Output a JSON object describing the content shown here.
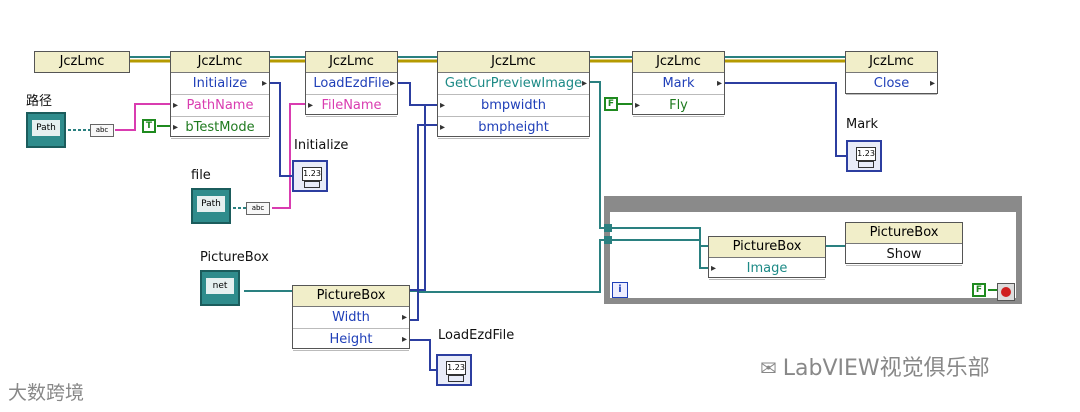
{
  "nodes": {
    "ctor": {
      "title": "JczLmc"
    },
    "init": {
      "title": "JczLmc",
      "rows": [
        "Initialize",
        "PathName",
        "bTestMode"
      ]
    },
    "load": {
      "title": "JczLmc",
      "rows": [
        "LoadEzdFile",
        "FileName"
      ]
    },
    "preview": {
      "title": "JczLmc",
      "rows": [
        "GetCurPreviewImage",
        "bmpwidth",
        "bmpheight"
      ]
    },
    "mark": {
      "title": "JczLmc",
      "rows": [
        "Mark",
        "Fly"
      ]
    },
    "close": {
      "title": "JczLmc",
      "rows": [
        "Close"
      ]
    },
    "pb_props": {
      "title": "PictureBox",
      "rows": [
        "Width",
        "Height"
      ]
    },
    "pb_image": {
      "title": "PictureBox",
      "rows": [
        "Image"
      ]
    },
    "pb_show": {
      "title": "PictureBox",
      "rows": [
        "Show"
      ]
    }
  },
  "labels": {
    "path": "路径",
    "file": "file",
    "picturebox": "PictureBox",
    "ind_initialize": "Initialize",
    "ind_load": "LoadEzdFile",
    "ind_mark": "Mark"
  },
  "controls": {
    "path_inner": "Path",
    "file_inner": "Path",
    "pb_inner": "net"
  },
  "constants": {
    "test_mode": "T",
    "fly": "F",
    "stop": "F",
    "iter": "i"
  },
  "indicator_value": "1.23",
  "converter": "abc",
  "watermarks": {
    "left": "大数跨境",
    "right": "LabVIEW视觉俱乐部"
  },
  "colors": {
    "refnum_wire": "#2a8080",
    "string_wire": "#d93cb0",
    "numeric_wire": "#2c3ea0",
    "error_wire": "#c8b400"
  }
}
